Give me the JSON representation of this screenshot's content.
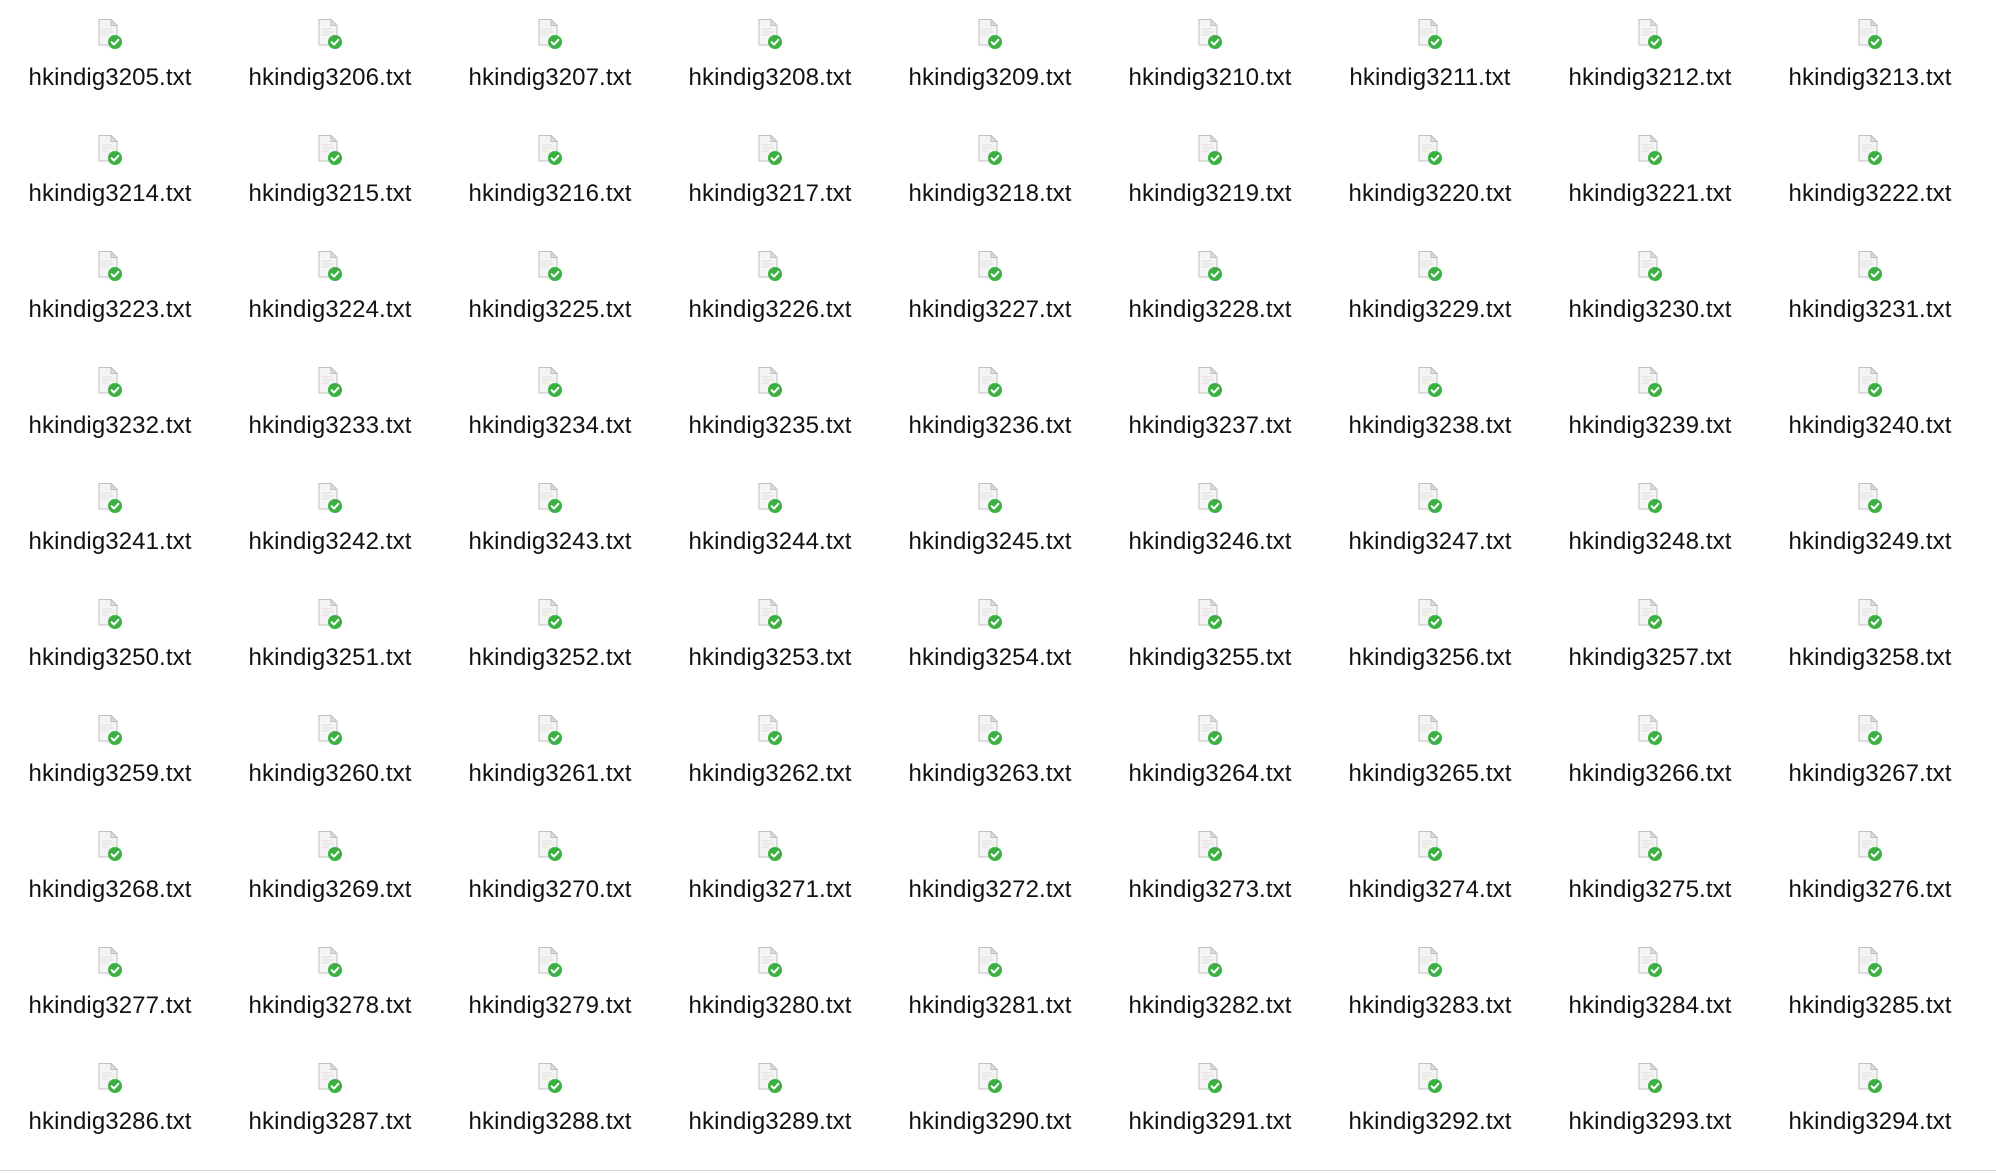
{
  "window": {
    "view_mode": "icon-grid"
  },
  "icon": {
    "name": "text-file-synced-icon",
    "badge_color": "#3cb043",
    "badge_check_color": "#ffffff",
    "paper_color": "#f4f4f4",
    "paper_border_color": "#bfbfbf",
    "fold_color": "#dddddd"
  },
  "files": [
    "hkindig3205.txt",
    "hkindig3206.txt",
    "hkindig3207.txt",
    "hkindig3208.txt",
    "hkindig3209.txt",
    "hkindig3210.txt",
    "hkindig3211.txt",
    "hkindig3212.txt",
    "hkindig3213.txt",
    "hkindig3214.txt",
    "hkindig3215.txt",
    "hkindig3216.txt",
    "hkindig3217.txt",
    "hkindig3218.txt",
    "hkindig3219.txt",
    "hkindig3220.txt",
    "hkindig3221.txt",
    "hkindig3222.txt",
    "hkindig3223.txt",
    "hkindig3224.txt",
    "hkindig3225.txt",
    "hkindig3226.txt",
    "hkindig3227.txt",
    "hkindig3228.txt",
    "hkindig3229.txt",
    "hkindig3230.txt",
    "hkindig3231.txt",
    "hkindig3232.txt",
    "hkindig3233.txt",
    "hkindig3234.txt",
    "hkindig3235.txt",
    "hkindig3236.txt",
    "hkindig3237.txt",
    "hkindig3238.txt",
    "hkindig3239.txt",
    "hkindig3240.txt",
    "hkindig3241.txt",
    "hkindig3242.txt",
    "hkindig3243.txt",
    "hkindig3244.txt",
    "hkindig3245.txt",
    "hkindig3246.txt",
    "hkindig3247.txt",
    "hkindig3248.txt",
    "hkindig3249.txt",
    "hkindig3250.txt",
    "hkindig3251.txt",
    "hkindig3252.txt",
    "hkindig3253.txt",
    "hkindig3254.txt",
    "hkindig3255.txt",
    "hkindig3256.txt",
    "hkindig3257.txt",
    "hkindig3258.txt",
    "hkindig3259.txt",
    "hkindig3260.txt",
    "hkindig3261.txt",
    "hkindig3262.txt",
    "hkindig3263.txt",
    "hkindig3264.txt",
    "hkindig3265.txt",
    "hkindig3266.txt",
    "hkindig3267.txt",
    "hkindig3268.txt",
    "hkindig3269.txt",
    "hkindig3270.txt",
    "hkindig3271.txt",
    "hkindig3272.txt",
    "hkindig3273.txt",
    "hkindig3274.txt",
    "hkindig3275.txt",
    "hkindig3276.txt",
    "hkindig3277.txt",
    "hkindig3278.txt",
    "hkindig3279.txt",
    "hkindig3280.txt",
    "hkindig3281.txt",
    "hkindig3282.txt",
    "hkindig3283.txt",
    "hkindig3284.txt",
    "hkindig3285.txt",
    "hkindig3286.txt",
    "hkindig3287.txt",
    "hkindig3288.txt",
    "hkindig3289.txt",
    "hkindig3290.txt",
    "hkindig3291.txt",
    "hkindig3292.txt",
    "hkindig3293.txt",
    "hkindig3294.txt"
  ]
}
